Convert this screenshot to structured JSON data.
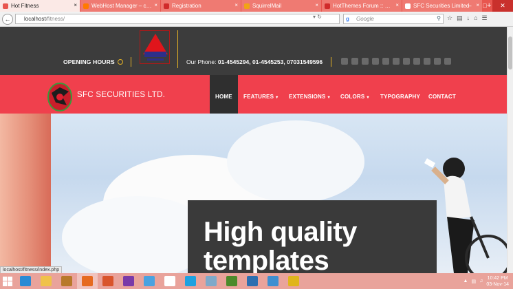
{
  "browser": {
    "tabs": [
      {
        "label": "Hot Fitness",
        "active": true,
        "fav_color": "#e8564f"
      },
      {
        "label": "WebHost Manager – cp...",
        "active": false,
        "fav_color": "#ff7a00"
      },
      {
        "label": "Registration",
        "active": false,
        "fav_color": "#d02b2b"
      },
      {
        "label": "SquirrelMail",
        "active": false,
        "fav_color": "#f1a316"
      },
      {
        "label": "HotThemes Forum :: Ne...",
        "active": false,
        "fav_color": "#d02b2b"
      },
      {
        "label": "SFC Securities Limited",
        "active": false,
        "fav_color": "#ffffff"
      }
    ],
    "url_host": "localhost",
    "url_path": "/fitness/",
    "search_placeholder": "Google",
    "status_text": "localhost/fitness/index.php"
  },
  "site": {
    "opening_hours": "OPENING HOURS",
    "phone_label": "Our Phone:",
    "phone_numbers": "01-4545294, 01-4545253, 07031549596",
    "brand_name": "SFC SECURITIES LTD.",
    "menu": [
      {
        "label": "HOME",
        "has_caret": false,
        "active": true
      },
      {
        "label": "FEATURES",
        "has_caret": true,
        "active": false
      },
      {
        "label": "EXTENSIONS",
        "has_caret": true,
        "active": false
      },
      {
        "label": "COLORS",
        "has_caret": true,
        "active": false
      },
      {
        "label": "TYPOGRAPHY",
        "has_caret": false,
        "active": false
      },
      {
        "label": "CONTACT",
        "has_caret": false,
        "active": false
      }
    ],
    "hero_line1": "High quality",
    "hero_line2": "templates",
    "social_icons": [
      "twitter-icon",
      "facebook-icon",
      "linkedin-icon",
      "pinterest-icon",
      "instagram-icon",
      "rss-icon",
      "flickr-icon",
      "tumblr-icon",
      "youtube-icon",
      "vimeo-icon",
      "googleplus-icon"
    ]
  },
  "taskbar": {
    "apps": [
      {
        "name": "ie-icon",
        "color": "#2a8ad4"
      },
      {
        "name": "explorer-icon",
        "color": "#f0c24a"
      },
      {
        "name": "app-brown-icon",
        "color": "#b8792a"
      },
      {
        "name": "firefox-icon",
        "color": "#e66a1f",
        "active": true
      },
      {
        "name": "photo-icon",
        "color": "#d9542b"
      },
      {
        "name": "onenote-icon",
        "color": "#7a3aa8"
      },
      {
        "name": "mail-icon",
        "color": "#4aa2e0"
      },
      {
        "name": "home-icon",
        "color": "#ffffff"
      },
      {
        "name": "skype-icon",
        "color": "#1ea1e0"
      },
      {
        "name": "tablet-icon",
        "color": "#7fa9c9"
      },
      {
        "name": "dreamweaver-icon",
        "color": "#4c8a2a"
      },
      {
        "name": "thunderbird-icon",
        "color": "#2d6fb0"
      },
      {
        "name": "globe-icon",
        "color": "#3f8fd0"
      },
      {
        "name": "app-yellow-icon",
        "color": "#e0b51c"
      }
    ],
    "time": "10:42 PM",
    "date": "03-Nov-14"
  },
  "colors": {
    "accent_red": "#f0404d",
    "dark": "#3c3c3c",
    "gold": "#e6b326"
  }
}
